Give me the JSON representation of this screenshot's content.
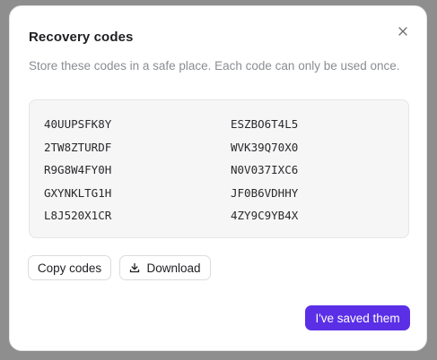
{
  "dialog": {
    "title": "Recovery codes",
    "subtitle": "Store these codes in a safe place. Each code can only be used once.",
    "close_icon": "close-icon"
  },
  "codes": [
    "40UUPSFK8Y",
    "ESZBO6T4L5",
    "2TW8ZTURDF",
    "WVK39Q70X0",
    "R9G8W4FY0H",
    "N0V037IXC6",
    "GXYNKLTG1H",
    "JF0B6VDHHY",
    "L8J520X1CR",
    "4ZY9C9YB4X"
  ],
  "actions": {
    "copy_label": "Copy codes",
    "download_label": "Download",
    "download_icon": "download-icon",
    "confirm_label": "I've saved them"
  },
  "colors": {
    "accent": "#5b2fe6",
    "overlay": "#8e8e8e",
    "codes_background": "#f6f6f6"
  }
}
